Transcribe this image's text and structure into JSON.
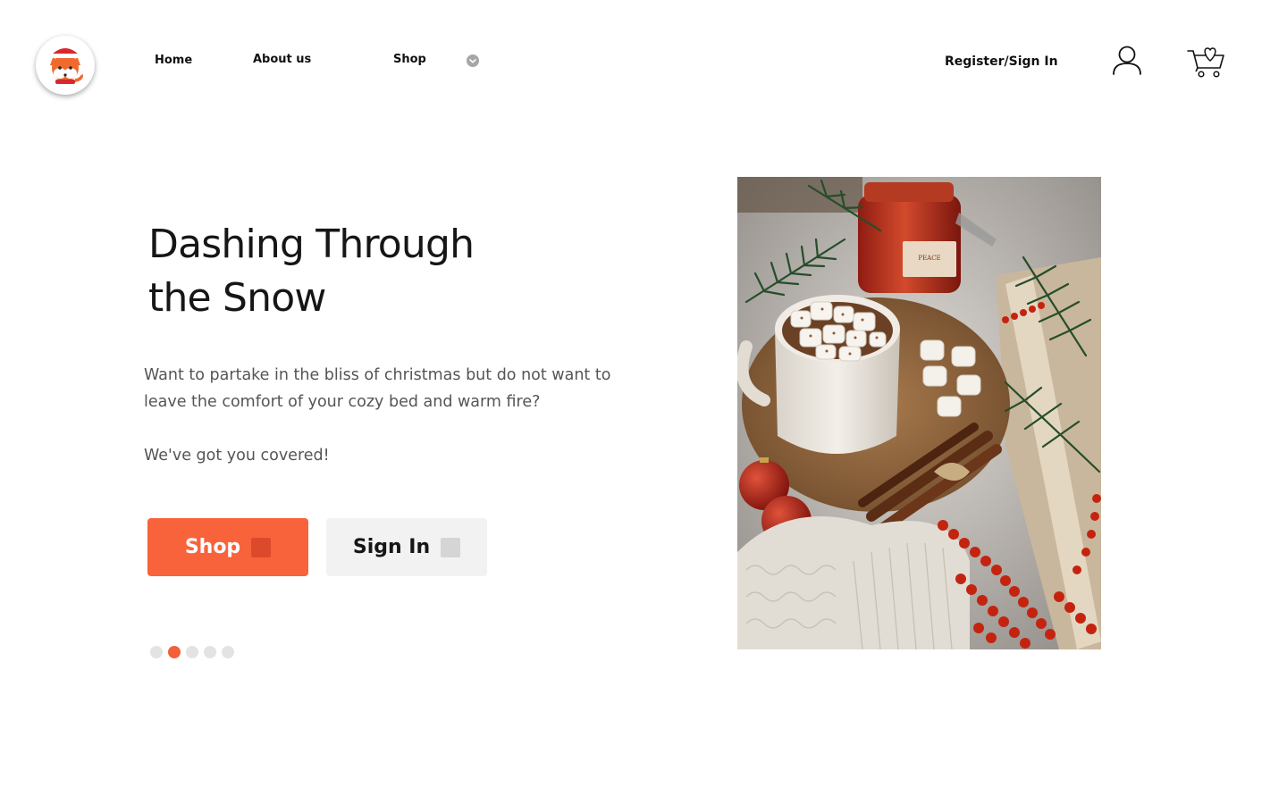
{
  "header": {
    "logo_icon": "fox-santa-hat-icon",
    "nav": {
      "home": "Home",
      "about": "About us",
      "shop": "Shop",
      "shop_dropdown_icon": "chevron-down-circle-icon"
    },
    "register_link": "Register/Sign In",
    "user_icon": "user-icon",
    "cart_icon": "cart-heart-icon"
  },
  "hero": {
    "title_line1": "Dashing Through",
    "title_line2": "the Snow",
    "description": "Want to partake in the bliss of christmas but do not want to leave the comfort of your cozy bed and warm fire?",
    "tagline": "We've got you covered!",
    "shop_button": "Shop",
    "signin_button": "Sign In",
    "carousel": {
      "total": 5,
      "active_index": 1
    },
    "image_alt": "Hot cocoa with marshmallows, candle, cinnamon sticks, ornaments and red beads on a cozy knit blanket",
    "image_candle_label": "PEACE"
  },
  "colors": {
    "accent": "#f9633c",
    "accent_dark": "#dc4a2c",
    "secondary_button": "#f2f2f2",
    "body_text": "#555555",
    "heading_text": "#161616",
    "dot_inactive": "#e3e3e3"
  }
}
